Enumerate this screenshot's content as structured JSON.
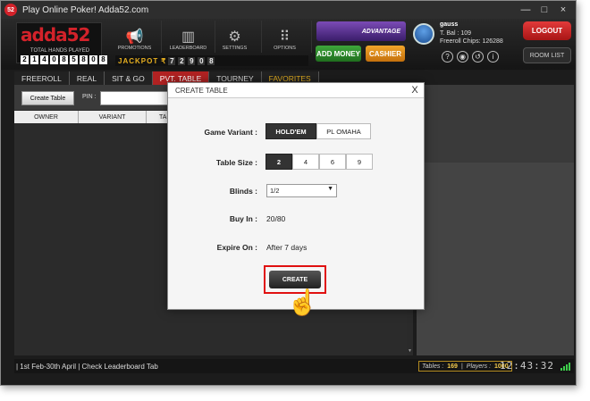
{
  "window": {
    "title": "Play Online Poker! Adda52.com",
    "app_icon": "52",
    "controls": [
      "—",
      "□",
      "×"
    ]
  },
  "header": {
    "logo": {
      "text": "adda52",
      "label": "TOTAL HANDS PLAYED",
      "counter": [
        "2",
        "1",
        "4",
        "0",
        "8",
        "5",
        "8",
        "0",
        "8"
      ]
    },
    "nav": [
      {
        "label": "PROMOTIONS",
        "icon": "megaphone-icon",
        "glyph": "📢"
      },
      {
        "label": "LEADERBOARD",
        "icon": "leaderboard-icon",
        "glyph": "▥"
      },
      {
        "label": "SETTINGS",
        "icon": "gear-icon",
        "glyph": "⚙"
      },
      {
        "label": "OPTIONS",
        "icon": "options-grid-icon",
        "glyph": "⠿"
      }
    ],
    "jackpot": {
      "label": "JACKPOT",
      "currency": "₹",
      "digits": [
        "7",
        "2",
        "9",
        "0",
        "8"
      ]
    },
    "advantage": "ADVANTAGE",
    "add_money": "ADD MONEY",
    "cashier": "CASHIER",
    "user": {
      "name": "gauss",
      "bal": "T. Bal : 109",
      "chips": "Freeroll Chips: 126288"
    },
    "icons": [
      "?",
      "◉",
      "↺",
      "i"
    ],
    "logout": "LOGOUT",
    "room_list": "ROOM LIST"
  },
  "tabs": [
    "FREEROLL",
    "REAL",
    "SIT & GO",
    "PVT. TABLE",
    "TOURNEY",
    "FAVORITES"
  ],
  "active_tab": "PVT. TABLE",
  "toolbar": {
    "create_table": "Create Table",
    "pin_label": "PIN :"
  },
  "columns": [
    "OWNER",
    "VARIANT",
    "TA"
  ],
  "status": {
    "ticker": "| 1st Feb-30th April | Check Leaderboard Tab",
    "tables_label": "Tables :",
    "tables": "169",
    "players_label": "Players :",
    "players": "1000",
    "clock": "12:43:32"
  },
  "modal": {
    "title": "CREATE TABLE",
    "close": "X",
    "game_variant_label": "Game Variant :",
    "variants": [
      "HOLD'EM",
      "PL OMAHA"
    ],
    "table_size_label": "Table Size :",
    "sizes": [
      "2",
      "4",
      "6",
      "9"
    ],
    "blinds_label": "Blinds :",
    "blinds_value": "1/2",
    "buy_in_label": "Buy In :",
    "buy_in_value": "20/80",
    "expire_label": "Expire On :",
    "expire_value": "After 7 days",
    "create_label": "CREATE"
  },
  "colors": {
    "brand_red": "#d3222a",
    "highlight": "#e01010",
    "active_tab": "#b22222"
  }
}
